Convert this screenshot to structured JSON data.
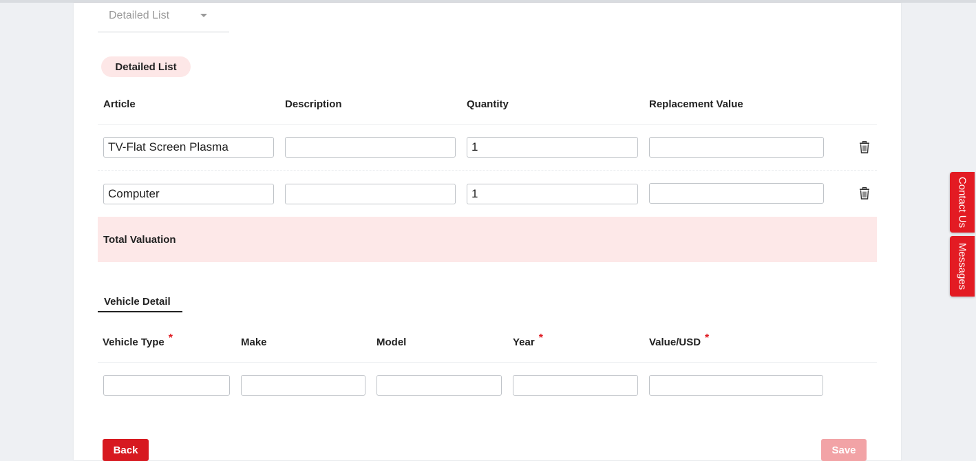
{
  "view_selector": {
    "label": "Detailed List"
  },
  "section_pill": "Detailed List",
  "items_table": {
    "headers": [
      "Article",
      "Description",
      "Quantity",
      "Replacement Value"
    ],
    "rows": [
      {
        "article": "TV-Flat Screen Plasma",
        "description": "",
        "quantity": "1",
        "replacement_value": ""
      },
      {
        "article": "Computer",
        "description": "",
        "quantity": "1",
        "replacement_value": ""
      }
    ],
    "total_label": "Total Valuation"
  },
  "vehicle_tab": "Vehicle Detail",
  "vehicle_table": {
    "headers": [
      "Vehicle Type",
      "Make",
      "Model",
      "Year",
      "Value/USD"
    ],
    "required_mark": "*",
    "row": {
      "vehicle_type": "",
      "make": "",
      "model": "",
      "year": "",
      "value_usd": ""
    }
  },
  "buttons": {
    "back": "Back",
    "save": "Save"
  },
  "side_tabs": {
    "contact": "Contact Us",
    "messages": "Messages"
  },
  "icons": {
    "delete": "trash-icon",
    "dropdown": "caret-down-icon"
  },
  "colors": {
    "brand_red": "#d71920",
    "save_disabled": "#f2a3a6",
    "total_row_bg": "#fde8e8",
    "pill_bg": "#fde7e7"
  }
}
